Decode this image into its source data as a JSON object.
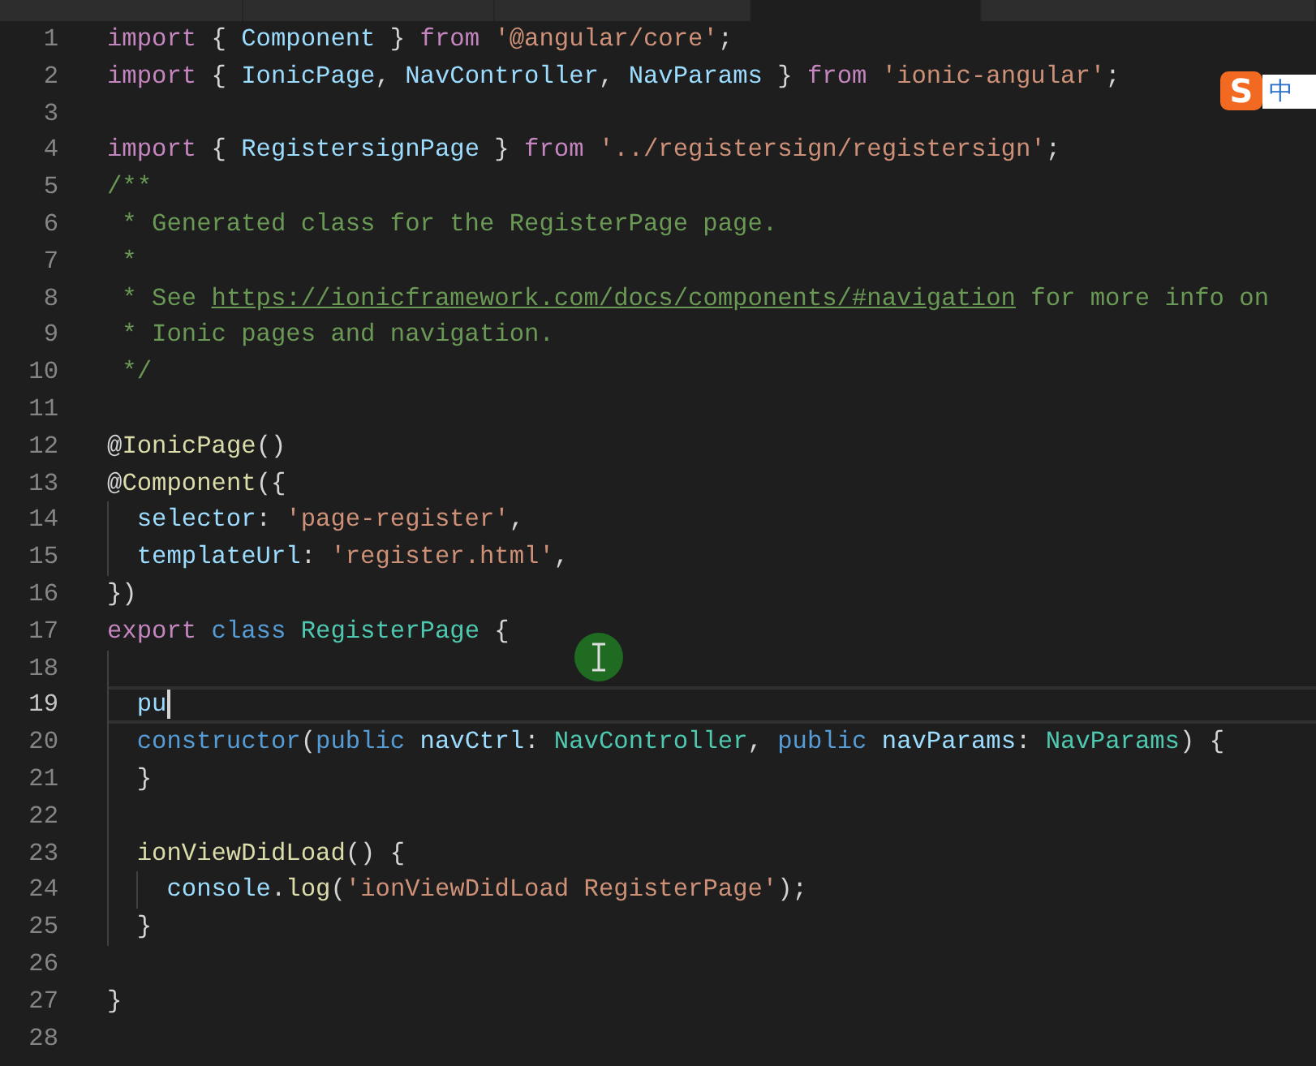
{
  "tabs": [
    {
      "selected": false
    },
    {
      "selected": false
    },
    {
      "selected": false
    },
    {
      "selected": true
    },
    {
      "selected": false
    }
  ],
  "ime": {
    "logo": "S",
    "mode": "中"
  },
  "lines": [
    {
      "number": "1",
      "tokens": [
        {
          "kind": "keyword",
          "text": "import"
        },
        {
          "kind": "plain",
          "text": " { "
        },
        {
          "kind": "variable",
          "text": "Component"
        },
        {
          "kind": "plain",
          "text": " } "
        },
        {
          "kind": "keyword",
          "text": "from "
        },
        {
          "kind": "string",
          "text": "'@angular/core'"
        },
        {
          "kind": "plain",
          "text": ";"
        }
      ]
    },
    {
      "number": "2",
      "tokens": [
        {
          "kind": "keyword",
          "text": "import"
        },
        {
          "kind": "plain",
          "text": " { "
        },
        {
          "kind": "variable",
          "text": "IonicPage"
        },
        {
          "kind": "plain",
          "text": ", "
        },
        {
          "kind": "variable",
          "text": "NavController"
        },
        {
          "kind": "plain",
          "text": ", "
        },
        {
          "kind": "variable",
          "text": "NavParams"
        },
        {
          "kind": "plain",
          "text": " } "
        },
        {
          "kind": "keyword",
          "text": "from "
        },
        {
          "kind": "string",
          "text": "'ionic-angular'"
        },
        {
          "kind": "plain",
          "text": ";"
        }
      ]
    },
    {
      "number": "3"
    },
    {
      "number": "4",
      "tokens": [
        {
          "kind": "keyword",
          "text": "import"
        },
        {
          "kind": "plain",
          "text": " { "
        },
        {
          "kind": "variable",
          "text": "RegistersignPage"
        },
        {
          "kind": "plain",
          "text": " } "
        },
        {
          "kind": "keyword",
          "text": "from "
        },
        {
          "kind": "string",
          "text": "'../registersign/registersign'"
        },
        {
          "kind": "plain",
          "text": ";"
        }
      ]
    },
    {
      "number": "5",
      "tokens": [
        {
          "kind": "comment",
          "text": "/**"
        }
      ]
    },
    {
      "number": "6",
      "tokens": [
        {
          "kind": "comment",
          "text": " * Generated class for the RegisterPage page."
        }
      ]
    },
    {
      "number": "7",
      "tokens": [
        {
          "kind": "comment",
          "text": " *"
        }
      ]
    },
    {
      "number": "8",
      "tokens": [
        {
          "kind": "comment",
          "text": " * See "
        },
        {
          "kind": "link",
          "text": "https://ionicframework.com/docs/components/#navigation"
        },
        {
          "kind": "comment",
          "text": " for more info on"
        }
      ]
    },
    {
      "number": "9",
      "tokens": [
        {
          "kind": "comment",
          "text": " * Ionic pages and navigation."
        }
      ]
    },
    {
      "number": "10",
      "tokens": [
        {
          "kind": "comment",
          "text": " */"
        }
      ]
    },
    {
      "number": "11"
    },
    {
      "number": "12",
      "tokens": [
        {
          "kind": "plain",
          "text": "@"
        },
        {
          "kind": "function",
          "text": "IonicPage"
        },
        {
          "kind": "plain",
          "text": "()"
        }
      ]
    },
    {
      "number": "13",
      "tokens": [
        {
          "kind": "plain",
          "text": "@"
        },
        {
          "kind": "function",
          "text": "Component"
        },
        {
          "kind": "plain",
          "text": "({"
        }
      ]
    },
    {
      "number": "14",
      "tokens": [
        {
          "kind": "variable",
          "text": "  selector"
        },
        {
          "kind": "plain",
          "text": ": "
        },
        {
          "kind": "string",
          "text": "'page-register'"
        },
        {
          "kind": "plain",
          "text": ","
        }
      ]
    },
    {
      "number": "15",
      "tokens": [
        {
          "kind": "variable",
          "text": "  templateUrl"
        },
        {
          "kind": "plain",
          "text": ": "
        },
        {
          "kind": "string",
          "text": "'register.html'"
        },
        {
          "kind": "plain",
          "text": ","
        }
      ]
    },
    {
      "number": "16",
      "tokens": [
        {
          "kind": "plain",
          "text": "})"
        }
      ]
    },
    {
      "number": "17",
      "tokens": [
        {
          "kind": "keyword",
          "text": "export "
        },
        {
          "kind": "storage",
          "text": "class "
        },
        {
          "kind": "type",
          "text": "RegisterPage"
        },
        {
          "kind": "plain",
          "text": " {"
        }
      ]
    },
    {
      "number": "18"
    },
    {
      "number": "19",
      "current": true,
      "tokens": [
        {
          "kind": "variable",
          "text": "  pu"
        }
      ]
    },
    {
      "number": "20",
      "tokens": [
        {
          "kind": "storage",
          "text": "  constructor"
        },
        {
          "kind": "plain",
          "text": "("
        },
        {
          "kind": "storage",
          "text": "public "
        },
        {
          "kind": "variable",
          "text": "navCtrl"
        },
        {
          "kind": "plain",
          "text": ": "
        },
        {
          "kind": "type",
          "text": "NavController"
        },
        {
          "kind": "plain",
          "text": ", "
        },
        {
          "kind": "storage",
          "text": "public "
        },
        {
          "kind": "variable",
          "text": "navParams"
        },
        {
          "kind": "plain",
          "text": ": "
        },
        {
          "kind": "type",
          "text": "NavParams"
        },
        {
          "kind": "plain",
          "text": ") {"
        }
      ]
    },
    {
      "number": "21",
      "tokens": [
        {
          "kind": "plain",
          "text": "  }"
        }
      ]
    },
    {
      "number": "22"
    },
    {
      "number": "23",
      "tokens": [
        {
          "kind": "function",
          "text": "  ionViewDidLoad"
        },
        {
          "kind": "plain",
          "text": "() {"
        }
      ]
    },
    {
      "number": "24",
      "tokens": [
        {
          "kind": "variable",
          "text": "    console"
        },
        {
          "kind": "plain",
          "text": "."
        },
        {
          "kind": "function",
          "text": "log"
        },
        {
          "kind": "plain",
          "text": "("
        },
        {
          "kind": "string",
          "text": "'ionViewDidLoad RegisterPage'"
        },
        {
          "kind": "plain",
          "text": ");"
        }
      ]
    },
    {
      "number": "25",
      "tokens": [
        {
          "kind": "plain",
          "text": "  }"
        }
      ]
    },
    {
      "number": "26"
    },
    {
      "number": "27",
      "tokens": [
        {
          "kind": "plain",
          "text": "}"
        }
      ]
    },
    {
      "number": "28"
    }
  ]
}
